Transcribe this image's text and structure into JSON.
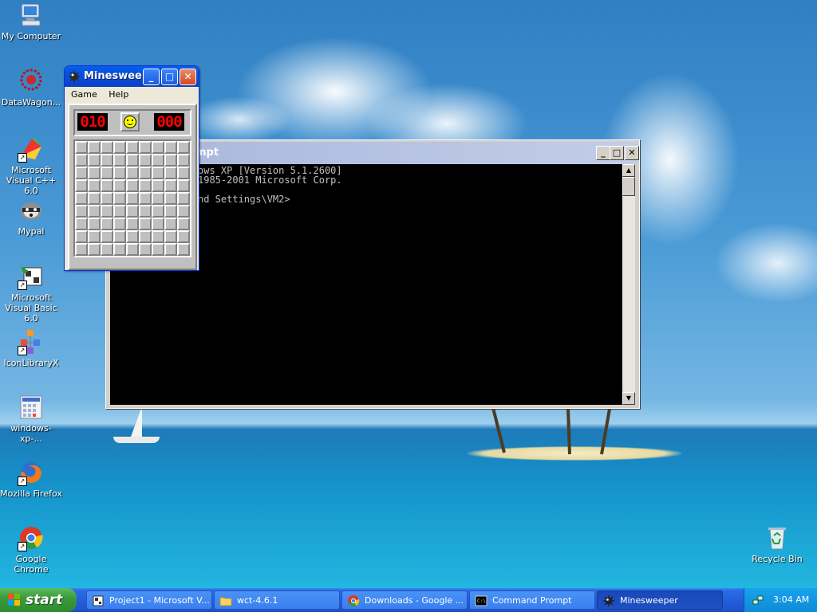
{
  "desktop_icons": [
    {
      "label": "My Computer",
      "icon": "computer-icon"
    },
    {
      "label": "DataWagon...",
      "icon": "datawagon-icon"
    },
    {
      "label": "Microsoft Visual C++ 6.0",
      "icon": "visual-cpp-icon"
    },
    {
      "label": "Mypal",
      "icon": "raccoon-icon"
    },
    {
      "label": "Microsoft Visual Basic 6.0",
      "icon": "visual-basic-icon"
    },
    {
      "label": "IconLibraryX",
      "icon": "icon-library-icon"
    },
    {
      "label": "windows-xp-...",
      "icon": "calculator-icon"
    },
    {
      "label": "Mozilla Firefox",
      "icon": "firefox-icon"
    },
    {
      "label": "Google Chrome",
      "icon": "chrome-icon"
    },
    {
      "label": "Recycle Bin",
      "icon": "recycle-bin-icon"
    }
  ],
  "cmd_window": {
    "title": "mpt",
    "lines": [
      "ows XP [Version 5.1.2600]",
      "1985-2001 Microsoft Corp.",
      "",
      "nd Settings\\VM2>"
    ],
    "buttons": {
      "minimize": "_",
      "maximize": "□",
      "close": "✕"
    }
  },
  "minesweeper": {
    "title": "Minesweе...",
    "menu": [
      "Game",
      "Help"
    ],
    "mines_counter": "010",
    "timer": "000",
    "rows": 9,
    "cols": 9
  },
  "taskbar": {
    "start_label": "start",
    "tasks": [
      {
        "label": "Project1 - Microsoft V...",
        "icon": "vb-project-icon"
      },
      {
        "label": "wct-4.6.1",
        "icon": "folder-icon"
      },
      {
        "label": "Downloads - Google ...",
        "icon": "chrome-icon"
      },
      {
        "label": "Command Prompt",
        "icon": "cmd-icon"
      },
      {
        "label": "Minesweeper",
        "icon": "minesweeper-icon"
      }
    ],
    "active_task": "Minesweeper",
    "clock": "3:04 AM"
  }
}
